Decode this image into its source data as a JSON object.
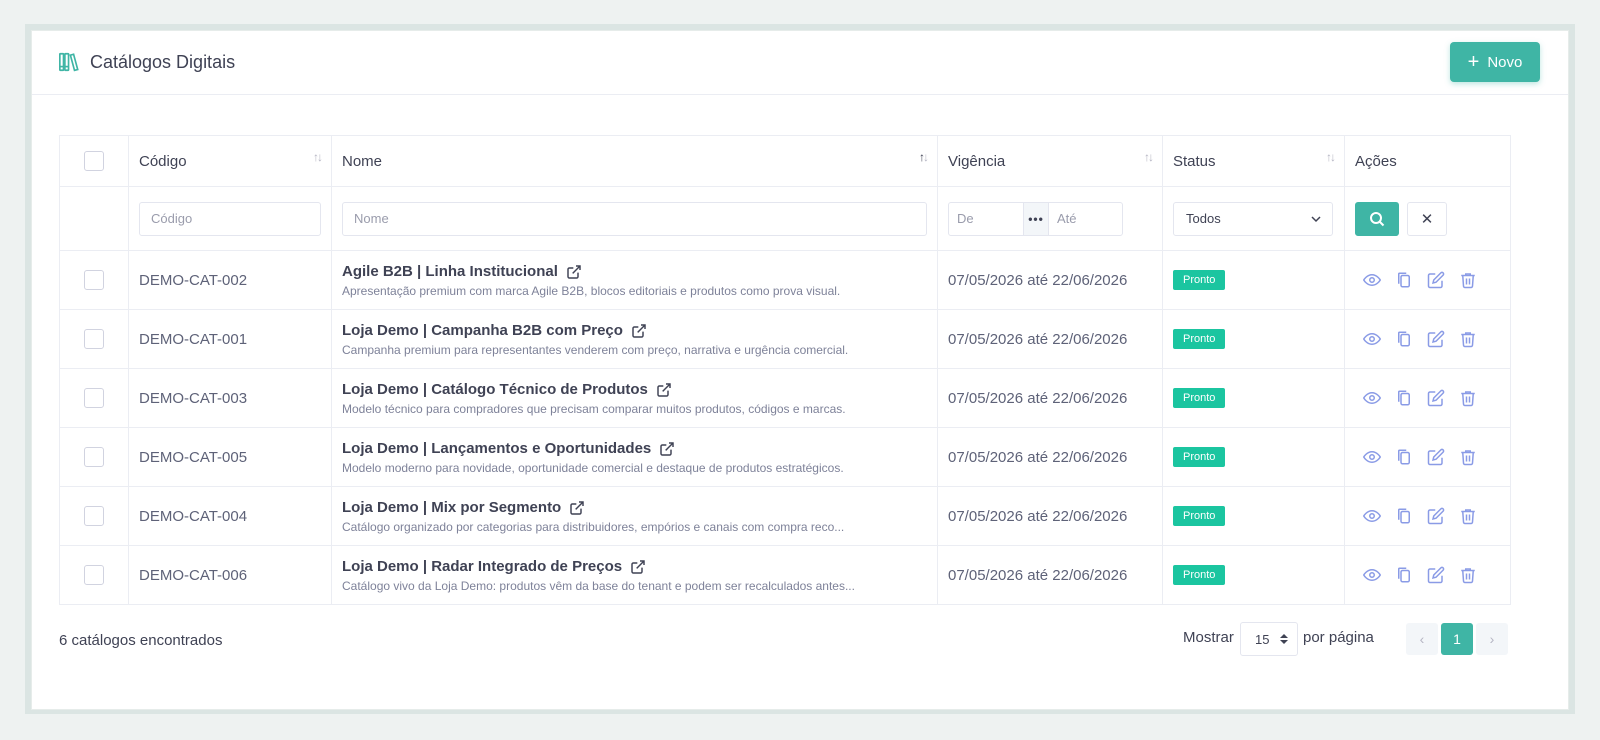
{
  "header": {
    "title": "Catálogos Digitais",
    "new_button": "Novo",
    "accent": "#3fb5a5"
  },
  "columns": {
    "code": "Código",
    "name": "Nome",
    "validity": "Vigência",
    "status": "Status",
    "actions": "Ações"
  },
  "filters": {
    "code_placeholder": "Código",
    "name_placeholder": "Nome",
    "from_placeholder": "De",
    "to_placeholder": "Até",
    "status_selected": "Todos"
  },
  "rows": [
    {
      "code": "DEMO-CAT-002",
      "name": "Agile B2B | Linha Institucional",
      "desc": "Apresentação premium com marca Agile B2B, blocos editoriais e produtos como prova visual.",
      "validity": "07/05/2026 até 22/06/2026",
      "status": "Pronto"
    },
    {
      "code": "DEMO-CAT-001",
      "name": "Loja Demo | Campanha B2B com Preço",
      "desc": "Campanha premium para representantes venderem com preço, narrativa e urgência comercial.",
      "validity": "07/05/2026 até 22/06/2026",
      "status": "Pronto"
    },
    {
      "code": "DEMO-CAT-003",
      "name": "Loja Demo | Catálogo Técnico de Produtos",
      "desc": "Modelo técnico para compradores que precisam comparar muitos produtos, códigos e marcas.",
      "validity": "07/05/2026 até 22/06/2026",
      "status": "Pronto"
    },
    {
      "code": "DEMO-CAT-005",
      "name": "Loja Demo | Lançamentos e Oportunidades",
      "desc": "Modelo moderno para novidade, oportunidade comercial e destaque de produtos estratégicos.",
      "validity": "07/05/2026 até 22/06/2026",
      "status": "Pronto"
    },
    {
      "code": "DEMO-CAT-004",
      "name": "Loja Demo | Mix por Segmento",
      "desc": "Catálogo organizado por categorias para distribuidores, empórios e canais com compra reco...",
      "validity": "07/05/2026 até 22/06/2026",
      "status": "Pronto"
    },
    {
      "code": "DEMO-CAT-006",
      "name": "Loja Demo | Radar Integrado de Preços",
      "desc": "Catálogo vivo da Loja Demo: produtos vêm da base do tenant e podem ser recalculados antes...",
      "validity": "07/05/2026 até 22/06/2026",
      "status": "Pronto"
    }
  ],
  "footer": {
    "count_text": "6 catálogos encontrados",
    "show_label": "Mostrar",
    "page_size": "15",
    "per_page_label": "por página",
    "current_page": "1"
  }
}
